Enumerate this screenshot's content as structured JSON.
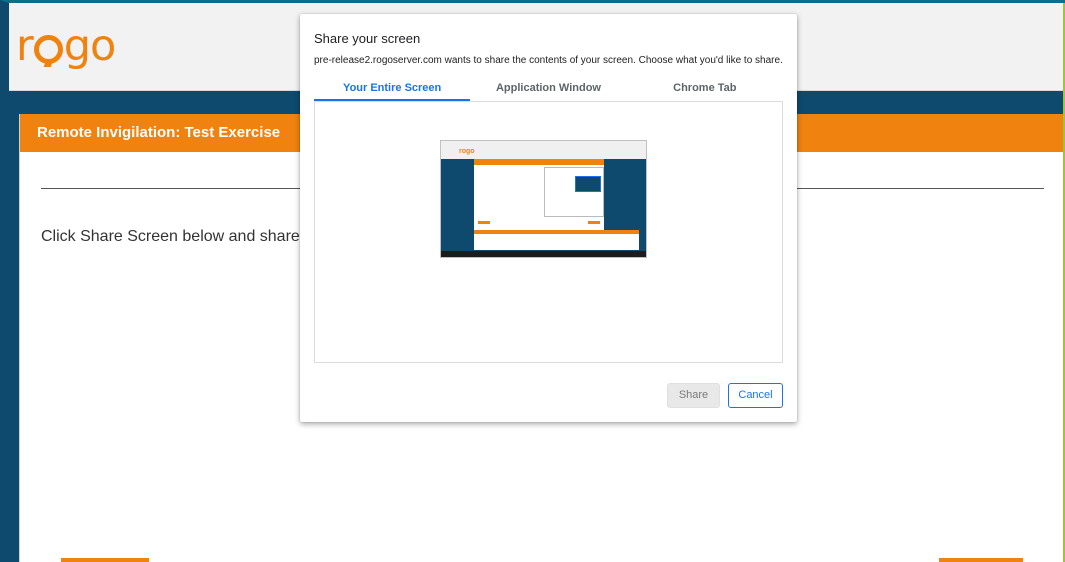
{
  "app": {
    "logo_text_before": "r",
    "logo_text_after": "go",
    "page_title": "Remote Invigilation: Test Exercise",
    "instruction": "Click Share Screen below and share y",
    "colors": {
      "accent": "#f0820f",
      "navy": "#0d4a6e",
      "link_blue": "#1a73e8"
    }
  },
  "dialog": {
    "title": "Share your screen",
    "subtitle": "pre-release2.rogoserver.com wants to share the contents of your screen. Choose what you'd like to share.",
    "tabs": [
      {
        "label": "Your Entire Screen",
        "active": true
      },
      {
        "label": "Application Window",
        "active": false
      },
      {
        "label": "Chrome Tab",
        "active": false
      }
    ],
    "share_label": "Share",
    "cancel_label": "Cancel"
  }
}
